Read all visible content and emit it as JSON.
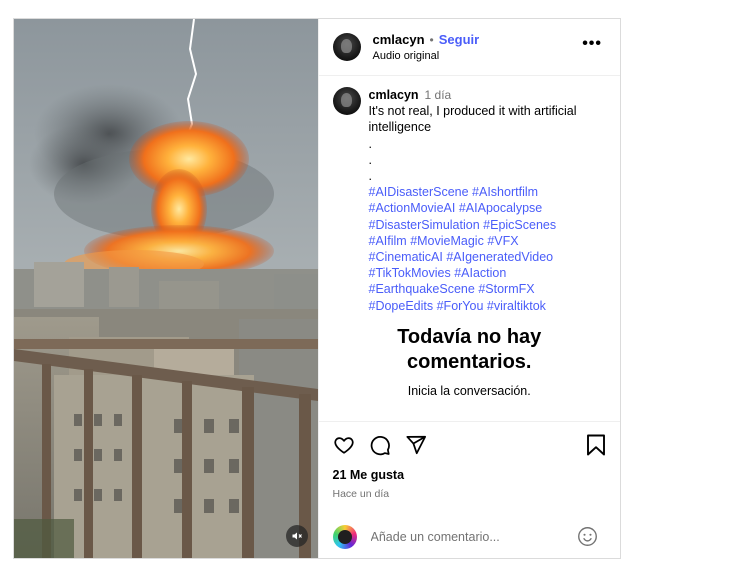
{
  "header": {
    "username": "cmlacyn",
    "separator": "•",
    "follow_label": "Seguir",
    "audio_label": "Audio original",
    "more_label": "•••"
  },
  "caption": {
    "username": "cmlacyn",
    "time": "1 día",
    "text": "It's not real, I produced it with artificial intelligence",
    "dot_lines": [
      ".",
      ".",
      "."
    ],
    "hashtag_lines": [
      [
        "#AIDisasterScene",
        "#AIshortfilm"
      ],
      [
        "#ActionMovieAI",
        "#AIApocalypse"
      ],
      [
        "#DisasterSimulation",
        "#EpicScenes"
      ],
      [
        "#AIfilm",
        "#MovieMagic",
        "#VFX"
      ],
      [
        "#CinematicAI",
        "#AIgeneratedVideo"
      ],
      [
        "#TikTokMovies",
        "#AIaction"
      ],
      [
        "#EarthquakeScene",
        "#StormFX"
      ],
      [
        "#DopeEdits",
        "#ForYou",
        "#viraltiktok"
      ]
    ]
  },
  "empty_comments": {
    "title": "Todavía no hay comentarios.",
    "subtitle": "Inicia la conversación."
  },
  "actions": {
    "likes": "21 Me gusta",
    "posted": "Hace un día",
    "icons": [
      "heart-icon",
      "comment-icon",
      "share-icon",
      "bookmark-icon"
    ]
  },
  "comment_bar": {
    "placeholder": "Añade un comentario..."
  },
  "media": {
    "mute_icon": "speaker-muted-icon"
  },
  "colors": {
    "link_blue": "#4a5df9",
    "muted_text": "#737373",
    "border": "#dbdbdb"
  }
}
